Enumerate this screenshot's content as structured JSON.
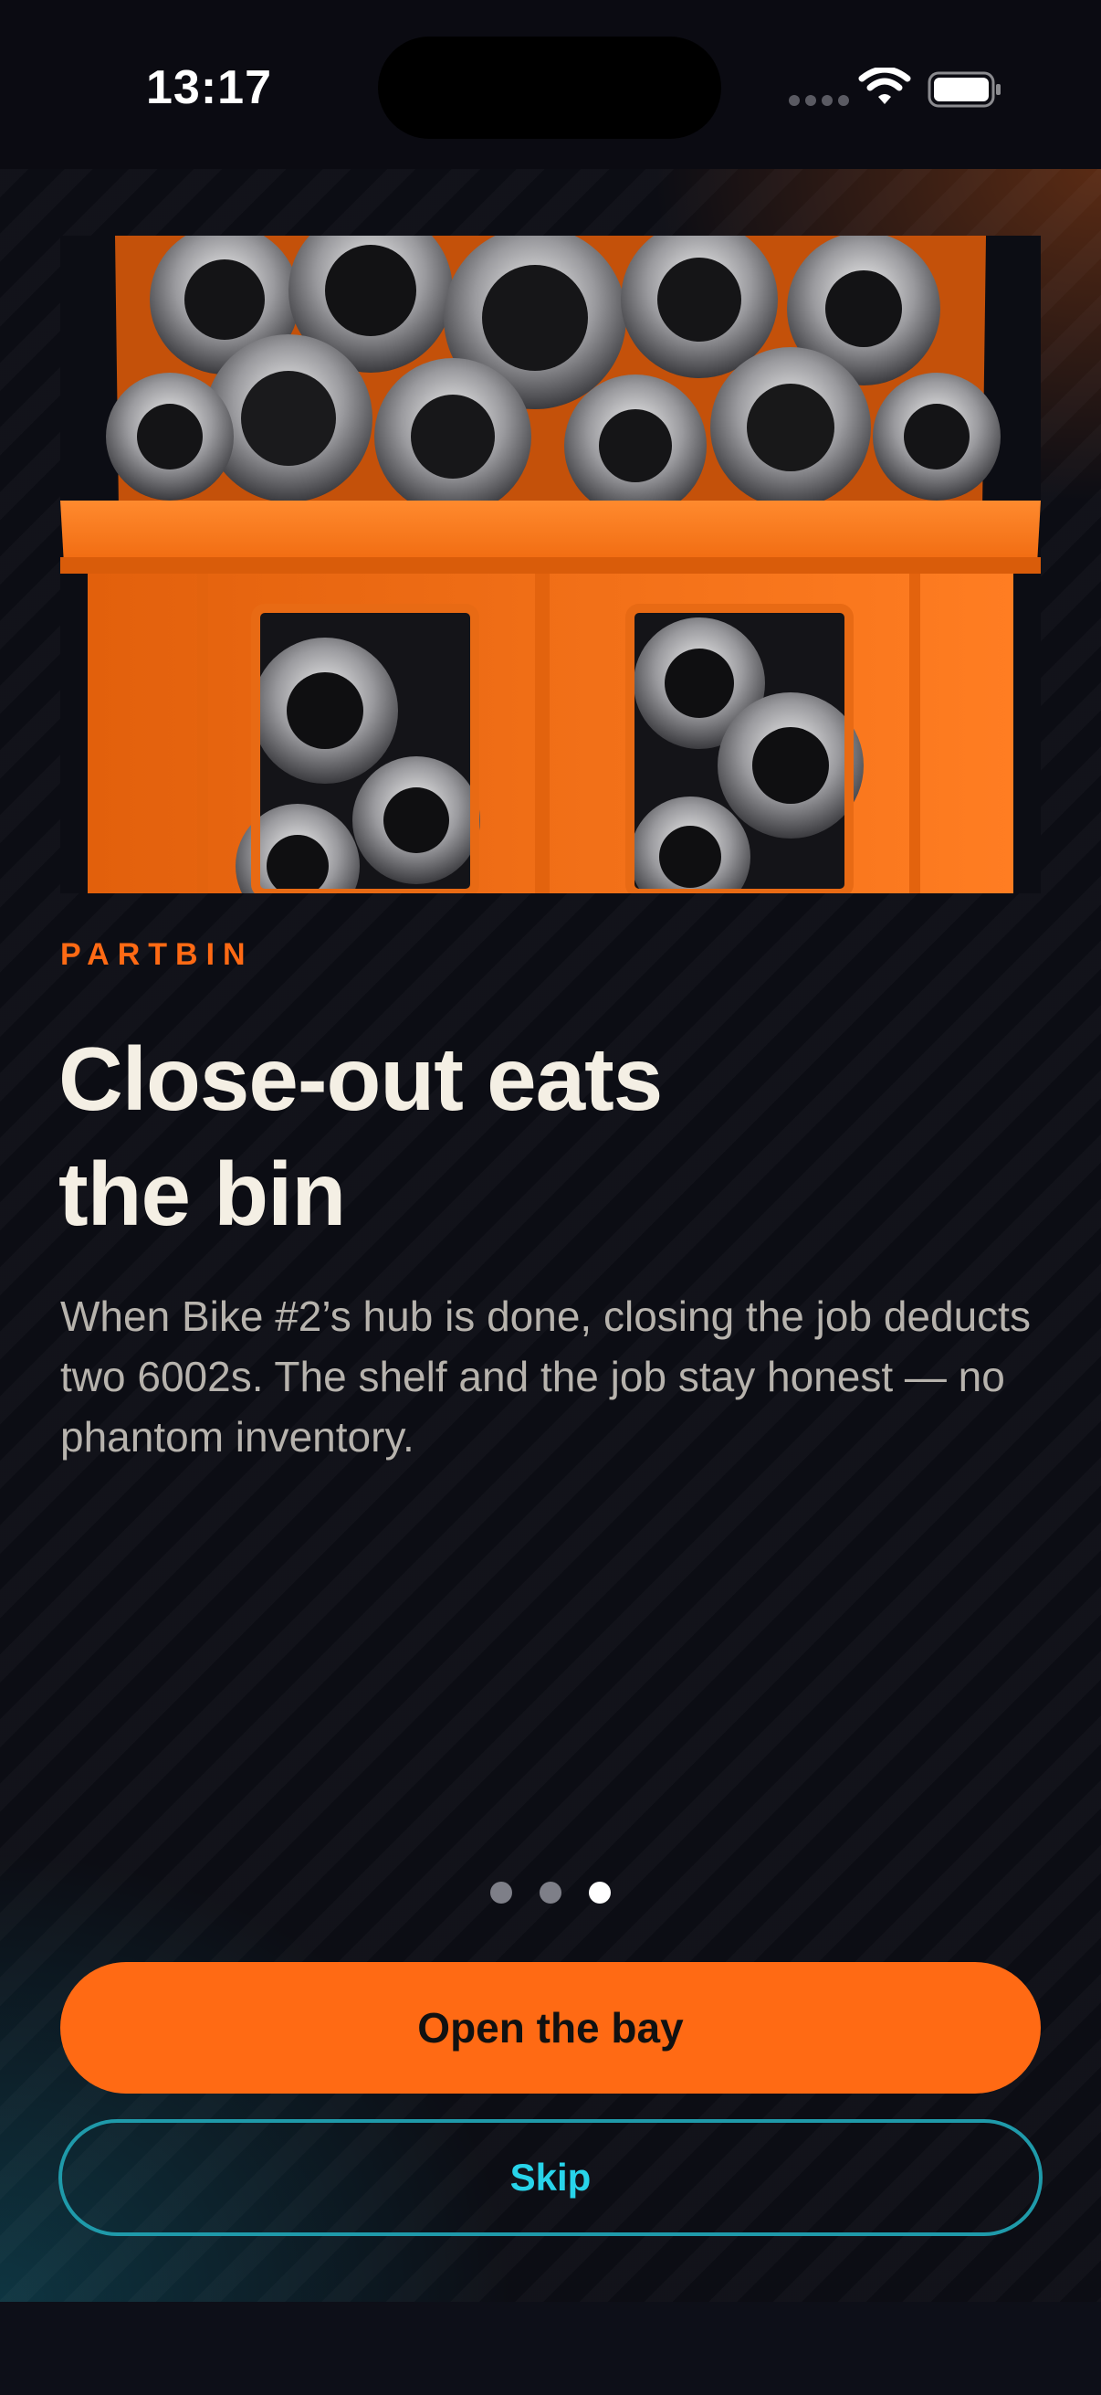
{
  "status_bar": {
    "time": "13:17"
  },
  "hero": {
    "image_description_icon": "crate-of-bearings-illustration"
  },
  "content": {
    "eyebrow": "PARTBIN",
    "headline_line1": "Close-out eats",
    "headline_line2": "the bin",
    "body": "When Bike #2’s hub is done, closing the job deducts two 6002s. The shelf and the job stay honest — no phantom inventory."
  },
  "pager": {
    "total": 3,
    "active_index": 2
  },
  "actions": {
    "primary_label": "Open the bay",
    "secondary_label": "Skip"
  },
  "colors": {
    "accent": "#ff6a14",
    "secondary": "#28d4ea",
    "background": "#0c0d14"
  }
}
